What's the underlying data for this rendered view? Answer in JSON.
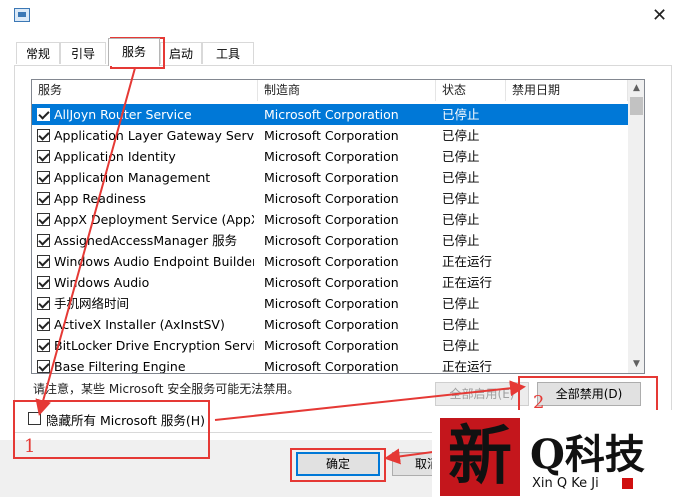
{
  "tabs": [
    "常规",
    "引导",
    "服务",
    "启动",
    "工具"
  ],
  "active_tab": "服务",
  "columns": [
    "服务",
    "制造商",
    "状态",
    "禁用日期"
  ],
  "services": [
    {
      "name": "AllJoyn Router Service",
      "maker": "Microsoft Corporation",
      "status": "已停止",
      "checked": true,
      "selected": true
    },
    {
      "name": "Application Layer Gateway Service",
      "maker": "Microsoft Corporation",
      "status": "已停止",
      "checked": true
    },
    {
      "name": "Application Identity",
      "maker": "Microsoft Corporation",
      "status": "已停止",
      "checked": true
    },
    {
      "name": "Application Management",
      "maker": "Microsoft Corporation",
      "status": "已停止",
      "checked": true
    },
    {
      "name": "App Readiness",
      "maker": "Microsoft Corporation",
      "status": "已停止",
      "checked": true
    },
    {
      "name": "AppX Deployment Service (AppX...",
      "maker": "Microsoft Corporation",
      "status": "已停止",
      "checked": true
    },
    {
      "name": "AssignedAccessManager 服务",
      "maker": "Microsoft Corporation",
      "status": "已停止",
      "checked": true
    },
    {
      "name": "Windows Audio Endpoint Builder",
      "maker": "Microsoft Corporation",
      "status": "正在运行",
      "checked": true
    },
    {
      "name": "Windows Audio",
      "maker": "Microsoft Corporation",
      "status": "正在运行",
      "checked": true
    },
    {
      "name": "手机网络时间",
      "maker": "Microsoft Corporation",
      "status": "已停止",
      "checked": true
    },
    {
      "name": "ActiveX Installer (AxInstSV)",
      "maker": "Microsoft Corporation",
      "status": "已停止",
      "checked": true
    },
    {
      "name": "BitLocker Drive Encryption Service",
      "maker": "Microsoft Corporation",
      "status": "已停止",
      "checked": true
    },
    {
      "name": "Base Filtering Engine",
      "maker": "Microsoft Corporation",
      "status": "正在运行",
      "checked": true
    }
  ],
  "note": "请注意，某些 Microsoft 安全服务可能无法禁用。",
  "buttons": {
    "enable_all": "全部启用(E)",
    "disable_all": "全部禁用(D)",
    "ok": "确定",
    "cancel": "取消"
  },
  "hide_ms_label": "隐藏所有 Microsoft 服务(H)",
  "hide_ms_checked": false,
  "annotations": {
    "step1": "1",
    "step2": "2"
  },
  "watermark": {
    "text": "新Q科技",
    "sub": "Xin Q Ke Ji"
  },
  "colors": {
    "selection": "#0078d7",
    "annotation": "#e53935"
  }
}
